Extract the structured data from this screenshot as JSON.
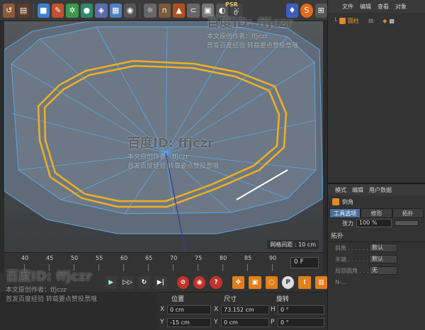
{
  "toolbar": {
    "psr_label": "PSR",
    "psr_value": "0",
    "icons": [
      "undo-icon",
      "film-icon",
      "cube-icon",
      "pen-icon",
      "gear-icon",
      "sphere-icon",
      "nurbs-icon",
      "grid-plane-icon",
      "camera-icon",
      "light-icon",
      "magnet-icon",
      "paint-icon",
      "spline-icon",
      "sculpt-icon",
      "render-icon",
      "dots-icon",
      "psr-icon",
      "shape-icon",
      "snap-icon"
    ]
  },
  "viewport": {
    "grid_readout": "网格间距 : 10 cm"
  },
  "timeline": {
    "ticks": [
      "40",
      "45",
      "50",
      "55",
      "60",
      "65",
      "70",
      "75",
      "80",
      "85",
      "90"
    ],
    "frame_value": "0 F"
  },
  "coords": {
    "header_position": "位置",
    "header_size": "尺寸",
    "header_rotation": "旋转",
    "rows": [
      {
        "axis": "X",
        "position": "0 cm",
        "size_axis": "X",
        "size": "73.152 cm",
        "rot_axis": "H",
        "rotation": "0 °"
      },
      {
        "axis": "Y",
        "position": "-15 cm",
        "size_axis": "Y",
        "size": "0 cm",
        "rot_axis": "P",
        "rotation": "0 °"
      }
    ]
  },
  "object_manager": {
    "menu": [
      "文件",
      "编辑",
      "查看",
      "对象"
    ],
    "object_name": "圆柱"
  },
  "attribute_manager": {
    "menu": [
      "模式",
      "编辑",
      "用户数据"
    ],
    "object_label": "倒角",
    "tabs": [
      "工具选项",
      "修形",
      "拓扑"
    ],
    "strength_label": "张力",
    "strength_value": "100 %",
    "section_topology": "拓扑",
    "props": [
      {
        "label": "斜角",
        "value": "默认"
      },
      {
        "label": "末端",
        "value": "默认"
      },
      {
        "label": "局部圆角",
        "value": "无"
      }
    ],
    "partial_label": "N-..."
  },
  "watermark": {
    "title": "百度ID: ffjczr",
    "line1": "本文原创作者：ffjczr",
    "line2": "首发百度经验 转载要点赞投票哦"
  },
  "colors": {
    "selection_edge": "#f0b020",
    "mesh_line": "#5aa8e8",
    "accent_tab": "#4a6f9a"
  }
}
